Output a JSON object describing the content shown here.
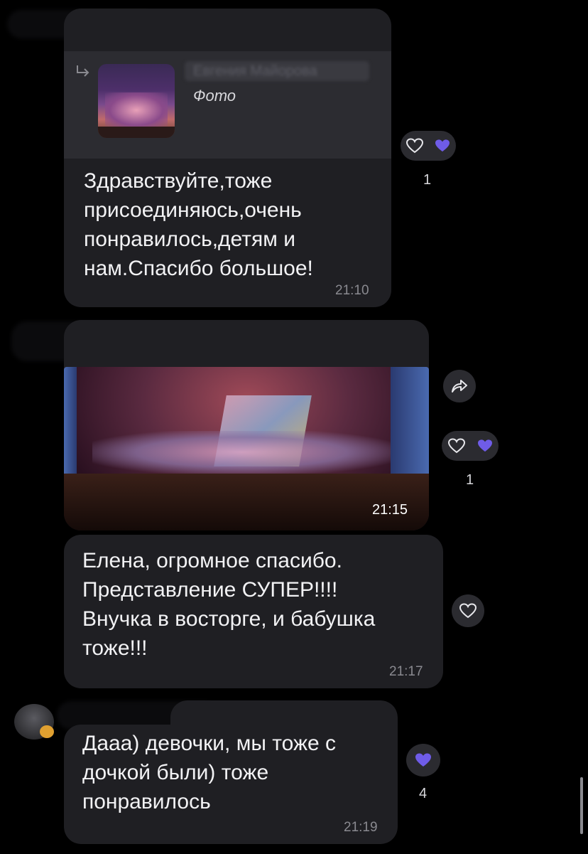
{
  "messages": [
    {
      "reply": {
        "author": "Евгения Майорова",
        "kind": "Фото"
      },
      "text": "Здравствуйте,тоже\nприсоединяюсь,очень\nпонравилось,детям и\nнам.Спасибо большое!",
      "time": "21:10",
      "reaction_count": "1"
    },
    {
      "photo_time": "21:15",
      "reaction_count": "1"
    },
    {
      "text": "Елена, огромное спасибо.\nПредставление СУПЕР!!!!\nВнучка в восторге, и бабушка\nтоже!!!",
      "time": "21:17"
    },
    {
      "text": "Дааа) девочки, мы тоже с\nдочкой были) тоже\nпонравилось",
      "time": "21:19",
      "reaction_count": "4"
    }
  ],
  "colors": {
    "background": "#000000",
    "bubble": "#1f1f23",
    "accent_heart": "#6f5ce8",
    "time_text": "#8a8a90"
  },
  "icons": [
    "reply-arrow-icon",
    "heart-outline-icon",
    "heart-filled-icon",
    "share-icon"
  ]
}
